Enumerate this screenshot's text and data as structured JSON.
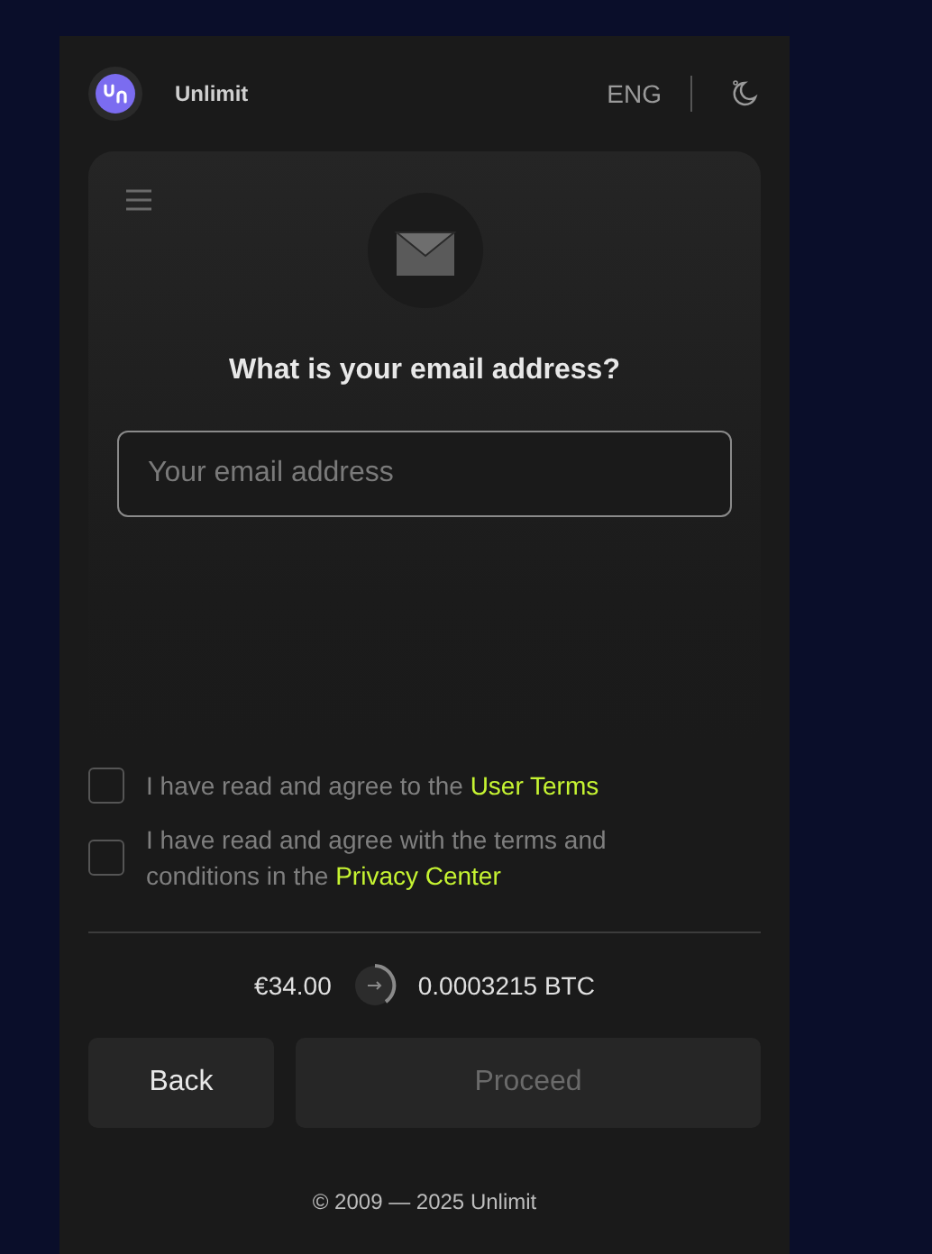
{
  "header": {
    "brand": "Unlimit",
    "language": "ENG"
  },
  "card": {
    "question": "What is your email address?",
    "email": {
      "placeholder": "Your email address",
      "focused": true
    }
  },
  "agreements": [
    {
      "text": "I have read and agree to the ",
      "link": "User Terms",
      "checked": false
    },
    {
      "text": "I have read and agree with the terms and conditions in the ",
      "link": "Privacy Center",
      "checked": false
    }
  ],
  "conversion": {
    "from": "€34.00",
    "to": "0.0003215 BTC"
  },
  "buttons": [
    {
      "label": "Back",
      "kind": "secondary",
      "disabled": false
    },
    {
      "label": "Proceed",
      "kind": "primary",
      "disabled": true
    }
  ],
  "footer": "© 2009 — 2025 Unlimit"
}
